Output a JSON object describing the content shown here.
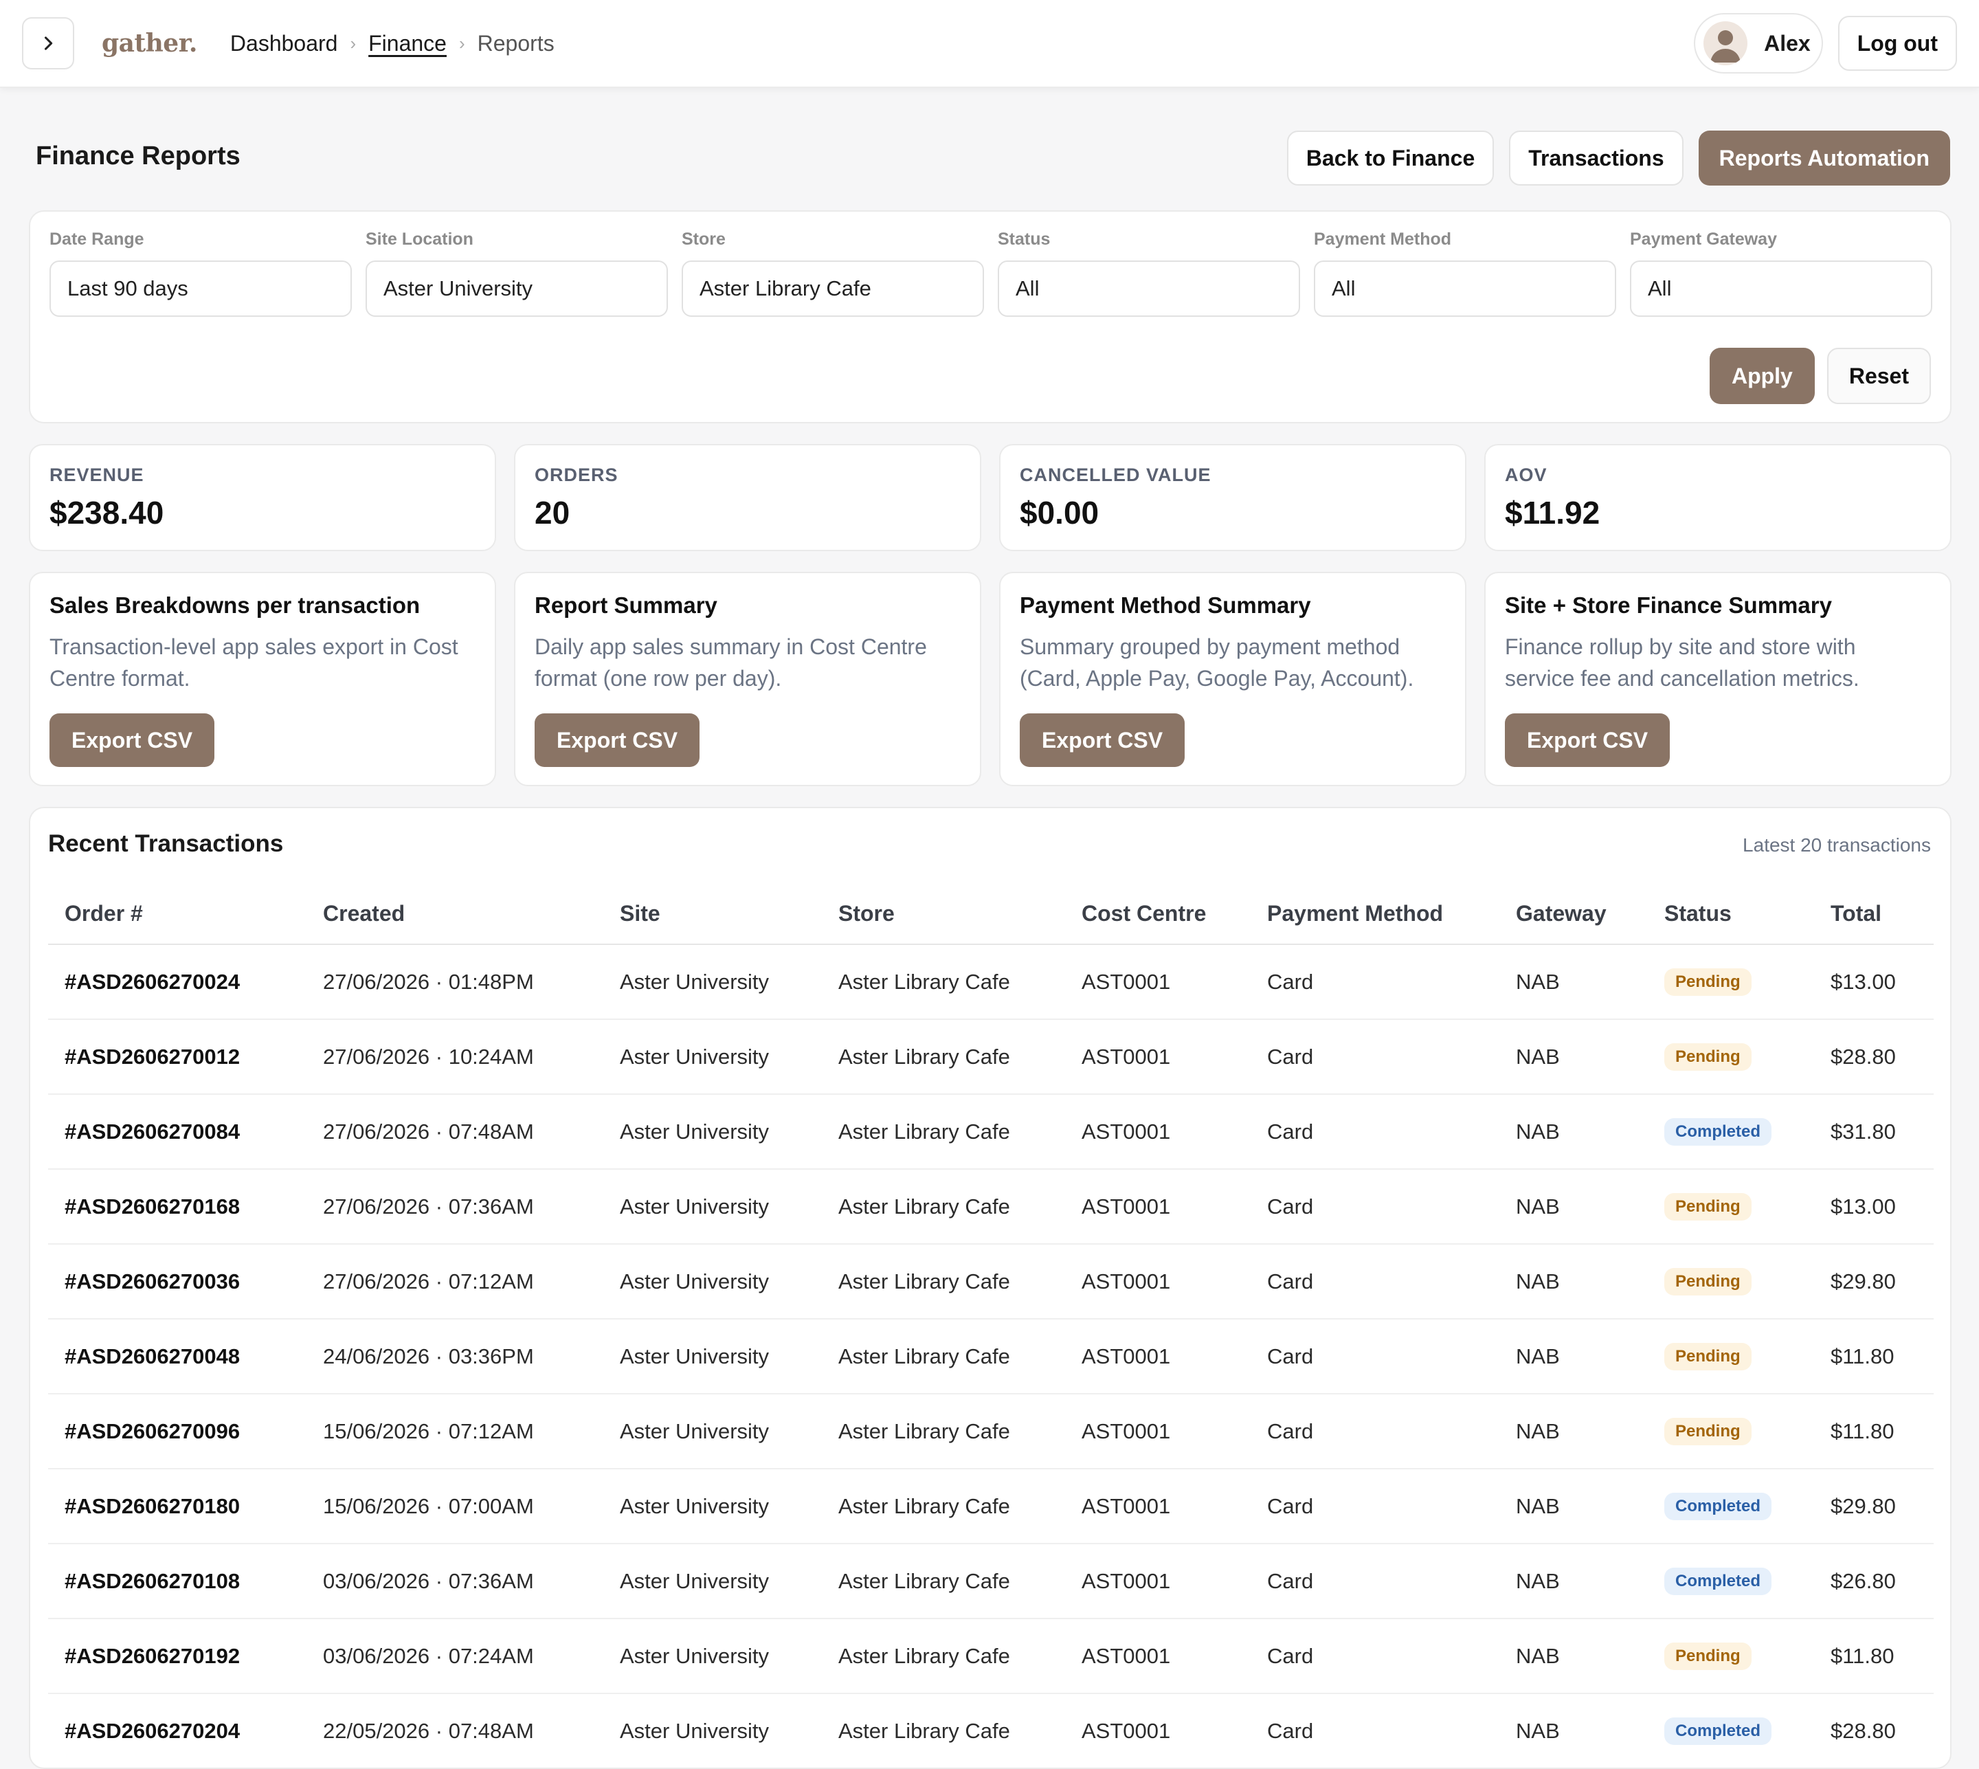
{
  "topbar": {
    "logo": "gather.",
    "breadcrumb": [
      "Dashboard",
      "Finance",
      "Reports"
    ],
    "user_name": "Alex",
    "logout_label": "Log out"
  },
  "header": {
    "title": "Finance Reports",
    "back_label": "Back to Finance",
    "transactions_label": "Transactions",
    "automation_label": "Reports Automation"
  },
  "filters": {
    "date_range": {
      "label": "Date Range",
      "value": "Last 90 days"
    },
    "site_location": {
      "label": "Site Location",
      "value": "Aster University"
    },
    "store": {
      "label": "Store",
      "value": "Aster Library Cafe"
    },
    "status": {
      "label": "Status",
      "value": "All"
    },
    "payment_method": {
      "label": "Payment Method",
      "value": "All"
    },
    "payment_gateway": {
      "label": "Payment Gateway",
      "value": "All"
    },
    "apply_label": "Apply",
    "reset_label": "Reset"
  },
  "kpis": [
    {
      "label": "REVENUE",
      "value": "$238.40"
    },
    {
      "label": "ORDERS",
      "value": "20"
    },
    {
      "label": "CANCELLED VALUE",
      "value": "$0.00"
    },
    {
      "label": "AOV",
      "value": "$11.92"
    }
  ],
  "reports": [
    {
      "title": "Sales Breakdowns per transaction",
      "desc": "Transaction-level app sales export in Cost Centre format.",
      "button": "Export CSV"
    },
    {
      "title": "Report Summary",
      "desc": "Daily app sales summary in Cost Centre format (one row per day).",
      "button": "Export CSV"
    },
    {
      "title": "Payment Method Summary",
      "desc": "Summary grouped by payment method (Card, Apple Pay, Google Pay, Account).",
      "button": "Export CSV"
    },
    {
      "title": "Site + Store Finance Summary",
      "desc": "Finance rollup by site and store with service fee and cancellation metrics.",
      "button": "Export CSV"
    }
  ],
  "transactions": {
    "title": "Recent Transactions",
    "subtitle": "Latest 20 transactions",
    "columns": [
      "Order #",
      "Created",
      "Site",
      "Store",
      "Cost Centre",
      "Payment Method",
      "Gateway",
      "Status",
      "Total"
    ],
    "rows": [
      {
        "order": "#ASD2606270024",
        "created": "27/06/2026 · 01:48PM",
        "site": "Aster University",
        "store": "Aster Library Cafe",
        "cost_centre": "AST0001",
        "method": "Card",
        "gateway": "NAB",
        "status": "Pending",
        "total": "$13.00"
      },
      {
        "order": "#ASD2606270012",
        "created": "27/06/2026 · 10:24AM",
        "site": "Aster University",
        "store": "Aster Library Cafe",
        "cost_centre": "AST0001",
        "method": "Card",
        "gateway": "NAB",
        "status": "Pending",
        "total": "$28.80"
      },
      {
        "order": "#ASD2606270084",
        "created": "27/06/2026 · 07:48AM",
        "site": "Aster University",
        "store": "Aster Library Cafe",
        "cost_centre": "AST0001",
        "method": "Card",
        "gateway": "NAB",
        "status": "Completed",
        "total": "$31.80"
      },
      {
        "order": "#ASD2606270168",
        "created": "27/06/2026 · 07:36AM",
        "site": "Aster University",
        "store": "Aster Library Cafe",
        "cost_centre": "AST0001",
        "method": "Card",
        "gateway": "NAB",
        "status": "Pending",
        "total": "$13.00"
      },
      {
        "order": "#ASD2606270036",
        "created": "27/06/2026 · 07:12AM",
        "site": "Aster University",
        "store": "Aster Library Cafe",
        "cost_centre": "AST0001",
        "method": "Card",
        "gateway": "NAB",
        "status": "Pending",
        "total": "$29.80"
      },
      {
        "order": "#ASD2606270048",
        "created": "24/06/2026 · 03:36PM",
        "site": "Aster University",
        "store": "Aster Library Cafe",
        "cost_centre": "AST0001",
        "method": "Card",
        "gateway": "NAB",
        "status": "Pending",
        "total": "$11.80"
      },
      {
        "order": "#ASD2606270096",
        "created": "15/06/2026 · 07:12AM",
        "site": "Aster University",
        "store": "Aster Library Cafe",
        "cost_centre": "AST0001",
        "method": "Card",
        "gateway": "NAB",
        "status": "Pending",
        "total": "$11.80"
      },
      {
        "order": "#ASD2606270180",
        "created": "15/06/2026 · 07:00AM",
        "site": "Aster University",
        "store": "Aster Library Cafe",
        "cost_centre": "AST0001",
        "method": "Card",
        "gateway": "NAB",
        "status": "Completed",
        "total": "$29.80"
      },
      {
        "order": "#ASD2606270108",
        "created": "03/06/2026 · 07:36AM",
        "site": "Aster University",
        "store": "Aster Library Cafe",
        "cost_centre": "AST0001",
        "method": "Card",
        "gateway": "NAB",
        "status": "Completed",
        "total": "$26.80"
      },
      {
        "order": "#ASD2606270192",
        "created": "03/06/2026 · 07:24AM",
        "site": "Aster University",
        "store": "Aster Library Cafe",
        "cost_centre": "AST0001",
        "method": "Card",
        "gateway": "NAB",
        "status": "Pending",
        "total": "$11.80"
      },
      {
        "order": "#ASD2606270204",
        "created": "22/05/2026 · 07:48AM",
        "site": "Aster University",
        "store": "Aster Library Cafe",
        "cost_centre": "AST0001",
        "method": "Card",
        "gateway": "NAB",
        "status": "Completed",
        "total": "$28.80"
      }
    ]
  },
  "colors": {
    "accent": "#8a7465",
    "pending_bg": "#fdf3e0",
    "pending_text": "#a3650a",
    "completed_bg": "#e6f0fb",
    "completed_text": "#2a5fa6"
  },
  "icons": {
    "toggle": "chevron-right-icon",
    "avatar": "user-avatar-icon"
  }
}
